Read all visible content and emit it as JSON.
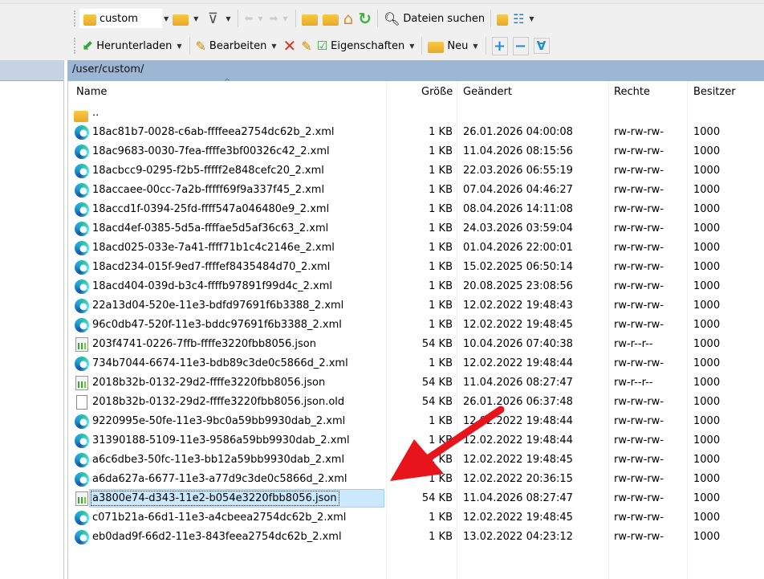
{
  "toolbar": {
    "location": "custom",
    "find_files": "Dateien suchen",
    "download": "Herunterladen",
    "edit": "Bearbeiten",
    "properties": "Eigenschaften",
    "new": "Neu"
  },
  "path": "/user/custom/",
  "columns": {
    "name": "Name",
    "size": "Größe",
    "changed": "Geändert",
    "rights": "Rechte",
    "owner": "Besitzer",
    "sort_indicator": "^"
  },
  "parent": "..",
  "files": [
    {
      "name": "18ac81b7-0028-c6ab-ffffeea2754dc62b_2.xml",
      "size": "1 KB",
      "changed": "26.01.2026 04:00:08",
      "rights": "rw-rw-rw-",
      "owner": "1000",
      "type": "xml"
    },
    {
      "name": "18ac9683-0030-7fea-ffffe3bf00326c42_2.xml",
      "size": "1 KB",
      "changed": "11.04.2026 08:15:56",
      "rights": "rw-rw-rw-",
      "owner": "1000",
      "type": "xml"
    },
    {
      "name": "18acbcc9-0295-f2b5-fffff2e848cefc20_2.xml",
      "size": "1 KB",
      "changed": "22.03.2026 06:55:19",
      "rights": "rw-rw-rw-",
      "owner": "1000",
      "type": "xml"
    },
    {
      "name": "18accaee-00cc-7a2b-fffff69f9a337f45_2.xml",
      "size": "1 KB",
      "changed": "07.04.2026 04:46:27",
      "rights": "rw-rw-rw-",
      "owner": "1000",
      "type": "xml"
    },
    {
      "name": "18accd1f-0394-25fd-ffff547a046480e9_2.xml",
      "size": "1 KB",
      "changed": "08.04.2026 14:11:08",
      "rights": "rw-rw-rw-",
      "owner": "1000",
      "type": "xml"
    },
    {
      "name": "18acd4ef-0385-5d5a-ffffae5d5af36c63_2.xml",
      "size": "1 KB",
      "changed": "24.03.2026 03:59:04",
      "rights": "rw-rw-rw-",
      "owner": "1000",
      "type": "xml"
    },
    {
      "name": "18acd025-033e-7a41-ffff71b1c4c2146e_2.xml",
      "size": "1 KB",
      "changed": "01.04.2026 22:00:01",
      "rights": "rw-rw-rw-",
      "owner": "1000",
      "type": "xml"
    },
    {
      "name": "18acd234-015f-9ed7-ffffef8435484d70_2.xml",
      "size": "1 KB",
      "changed": "15.02.2025 06:50:14",
      "rights": "rw-rw-rw-",
      "owner": "1000",
      "type": "xml"
    },
    {
      "name": "18acd404-039d-b3c4-ffffb97891f99d4c_2.xml",
      "size": "1 KB",
      "changed": "20.08.2025 23:08:56",
      "rights": "rw-rw-rw-",
      "owner": "1000",
      "type": "xml"
    },
    {
      "name": "22a13d04-520e-11e3-bdfd97691f6b3388_2.xml",
      "size": "1 KB",
      "changed": "12.02.2022 19:48:43",
      "rights": "rw-rw-rw-",
      "owner": "1000",
      "type": "xml"
    },
    {
      "name": "96c0db47-520f-11e3-bddc97691f6b3388_2.xml",
      "size": "1 KB",
      "changed": "12.02.2022 19:48:45",
      "rights": "rw-rw-rw-",
      "owner": "1000",
      "type": "xml"
    },
    {
      "name": "203f4741-0226-7ffb-ffffe3220fbb8056.json",
      "size": "54 KB",
      "changed": "10.04.2026 07:40:38",
      "rights": "rw-r--r--",
      "owner": "1000",
      "type": "json"
    },
    {
      "name": "734b7044-6674-11e3-bdb89c3de0c5866d_2.xml",
      "size": "1 KB",
      "changed": "12.02.2022 19:48:44",
      "rights": "rw-rw-rw-",
      "owner": "1000",
      "type": "xml"
    },
    {
      "name": "2018b32b-0132-29d2-ffffe3220fbb8056.json",
      "size": "54 KB",
      "changed": "11.04.2026 08:27:47",
      "rights": "rw-r--r--",
      "owner": "1000",
      "type": "json"
    },
    {
      "name": "2018b32b-0132-29d2-ffffe3220fbb8056.json.old",
      "size": "54 KB",
      "changed": "26.01.2026 06:37:48",
      "rights": "rw-rw-rw-",
      "owner": "1000",
      "type": "file"
    },
    {
      "name": "9220995e-50fe-11e3-9bc0a59bb9930dab_2.xml",
      "size": "1 KB",
      "changed": "12.02.2022 19:48:44",
      "rights": "rw-rw-rw-",
      "owner": "1000",
      "type": "xml"
    },
    {
      "name": "31390188-5109-11e3-9586a59bb9930dab_2.xml",
      "size": "1 KB",
      "changed": "12.02.2022 19:48:44",
      "rights": "rw-rw-rw-",
      "owner": "1000",
      "type": "xml"
    },
    {
      "name": "a6c6dbe3-50fc-11e3-bb12a59bb9930dab_2.xml",
      "size": "1 KB",
      "changed": "12.02.2022 19:48:45",
      "rights": "rw-rw-rw-",
      "owner": "1000",
      "type": "xml"
    },
    {
      "name": "a6da627a-6677-11e3-a77d9c3de0c5866d_2.xml",
      "size": "1 KB",
      "changed": "12.02.2022 20:36:15",
      "rights": "rw-rw-rw-",
      "owner": "1000",
      "type": "xml"
    },
    {
      "name": "a3800e74-d343-11e2-b054e3220fbb8056.json",
      "size": "54 KB",
      "changed": "11.04.2026 08:27:47",
      "rights": "rw-rw-rw-",
      "owner": "1000",
      "type": "json",
      "selected": true
    },
    {
      "name": "c071b21a-66d1-11e3-a4cbeea2754dc62b_2.xml",
      "size": "1 KB",
      "changed": "12.02.2022 19:48:45",
      "rights": "rw-rw-rw-",
      "owner": "1000",
      "type": "xml"
    },
    {
      "name": "eb0dad9f-66d2-11e3-843feea2754dc62b_2.xml",
      "size": "1 KB",
      "changed": "13.02.2022 04:23:12",
      "rights": "rw-rw-rw-",
      "owner": "1000",
      "type": "xml"
    }
  ],
  "annotation": {
    "type": "arrow",
    "color": "#e8141c"
  }
}
